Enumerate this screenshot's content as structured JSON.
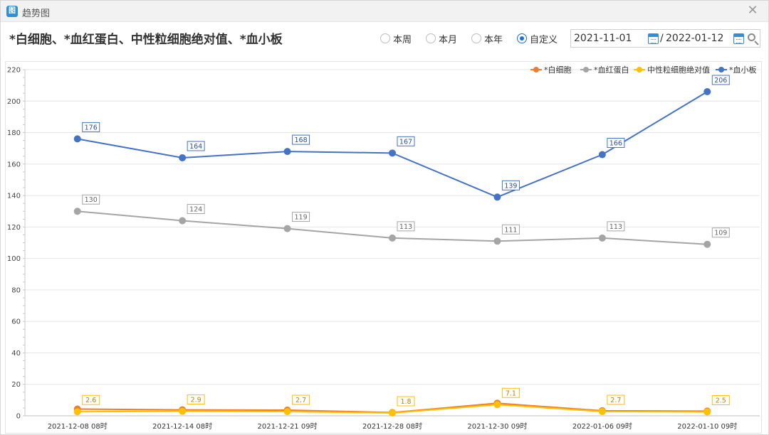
{
  "window": {
    "title": "趋势图",
    "app_icon_glyph": "图"
  },
  "header": {
    "title": "*白细胞、*血红蛋白、中性粒细胞绝对值、*血小板",
    "range_options": [
      {
        "label": "本周",
        "checked": false
      },
      {
        "label": "本月",
        "checked": false
      },
      {
        "label": "本年",
        "checked": false
      },
      {
        "label": "自定义",
        "checked": true
      }
    ],
    "date_from": "2021-11-01",
    "date_separator": "/",
    "date_to": "2022-01-12"
  },
  "icons": {
    "close": "close-icon",
    "calendar": "calendar-icon",
    "search": "search-icon"
  },
  "chart_data": {
    "type": "line",
    "categories": [
      "2021-12-08 08时",
      "2021-12-14 08时",
      "2021-12-21 09时",
      "2021-12-28 08时",
      "2021-12-30 09时",
      "2022-01-06 09时",
      "2022-01-10 09时"
    ],
    "series": [
      {
        "name": "*白细胞",
        "color": "#ed7d31",
        "values": [
          4.3,
          3.8,
          3.6,
          2.1,
          8.0,
          3.2,
          3.0
        ],
        "labels_shown": false
      },
      {
        "name": "*血红蛋白",
        "color": "#a5a5a5",
        "values": [
          130,
          124,
          119,
          113,
          111,
          113,
          109
        ],
        "labels_shown": true
      },
      {
        "name": "中性粒细胞绝对值",
        "color": "#ffc000",
        "values": [
          2.6,
          2.9,
          2.7,
          1.8,
          7.1,
          2.7,
          2.5
        ],
        "labels_shown": true
      },
      {
        "name": "*血小板",
        "color": "#4472c4",
        "values": [
          176,
          164,
          168,
          167,
          139,
          166,
          206
        ],
        "labels_shown": true
      }
    ],
    "xlabel": "",
    "ylabel": "",
    "ylim": [
      0,
      220
    ],
    "yticks": [
      0,
      20,
      40,
      60,
      80,
      100,
      120,
      140,
      160,
      180,
      200,
      220
    ],
    "grid": true,
    "legend_position": "top-right"
  }
}
